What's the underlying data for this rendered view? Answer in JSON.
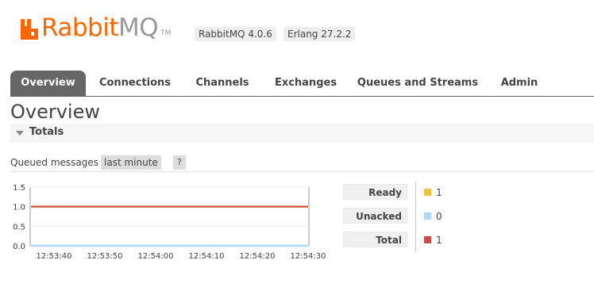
{
  "header": {
    "logo_rabbit": "Rabbit",
    "logo_mq": "MQ",
    "logo_tm": "TM",
    "rabbitmq_version": "RabbitMQ 4.0.6",
    "erlang_version": "Erlang 27.2.2",
    "brand_color": "#ff6600"
  },
  "nav": {
    "tabs": [
      {
        "label": "Overview",
        "active": true
      },
      {
        "label": "Connections",
        "active": false
      },
      {
        "label": "Channels",
        "active": false
      },
      {
        "label": "Exchanges",
        "active": false
      },
      {
        "label": "Queues and Streams",
        "active": false
      },
      {
        "label": "Admin",
        "active": false
      }
    ]
  },
  "page": {
    "title": "Overview",
    "section_title": "Totals"
  },
  "queued": {
    "label": "Queued messages",
    "period": "last minute",
    "help": "?"
  },
  "legend": [
    {
      "label": "Ready",
      "value": "1",
      "color": "#edc240"
    },
    {
      "label": "Unacked",
      "value": "0",
      "color": "#afd8f8"
    },
    {
      "label": "Total",
      "value": "1",
      "color": "#cb4b4b"
    }
  ],
  "chart_data": {
    "type": "line",
    "x": [
      "12:53:40",
      "12:53:50",
      "12:54:00",
      "12:54:10",
      "12:54:20",
      "12:54:30"
    ],
    "ylim": [
      0,
      1.5
    ],
    "yticks": [
      "1.5",
      "1.0",
      "0.5",
      "0.0"
    ],
    "series": [
      {
        "name": "Ready",
        "color": "#edc240",
        "values": [
          1,
          1,
          1,
          1,
          1,
          1
        ]
      },
      {
        "name": "Unacked",
        "color": "#afd8f8",
        "values": [
          0,
          0,
          0,
          0,
          0,
          0
        ]
      },
      {
        "name": "Total",
        "color": "#cb4b4b",
        "values": [
          1,
          1,
          1,
          1,
          1,
          1
        ]
      }
    ]
  }
}
